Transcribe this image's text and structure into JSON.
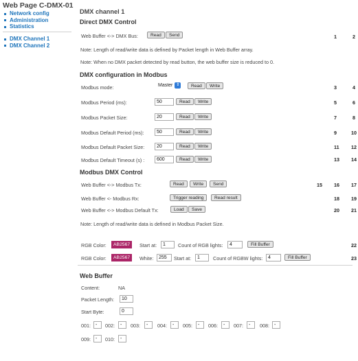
{
  "sidebar": {
    "title": "Web Page C-DMX-01",
    "nav": [
      "Network config",
      "Administration",
      "Statistics"
    ],
    "channels": [
      "DMX Channel 1",
      "DMX Channel 2"
    ]
  },
  "page_title": "DMX channel 1",
  "direct": {
    "heading": "Direct DMX Control",
    "row_label": "Web Buffer <-> DMX Bus:",
    "read": "Read",
    "send": "Send",
    "nums": [
      "1",
      "2"
    ],
    "note1": "Note: Length of read/write data is defined by Packet length in Web Buffer array.",
    "note2": "Note: When no DMX packet detected by read button, the web buffer size is reduced to 0."
  },
  "config": {
    "heading": "DMX configuration in Modbus",
    "mode": {
      "label": "Modbus mode:",
      "value": "Master",
      "read": "Read",
      "write": "Write",
      "nums": [
        "3",
        "4"
      ]
    },
    "rows": [
      {
        "label": "Modbus Period (ms):",
        "value": "50",
        "read": "Read",
        "write": "Write",
        "nums": [
          "5",
          "6"
        ]
      },
      {
        "label": "Modbus Packet Size:",
        "value": "20",
        "read": "Read",
        "write": "Write",
        "nums": [
          "7",
          "8"
        ]
      },
      {
        "label": "Modbus Default Period (ms):",
        "value": "50",
        "read": "Read",
        "write": "Write",
        "nums": [
          "9",
          "10"
        ]
      },
      {
        "label": "Modbus Default Packet Size:",
        "value": "20",
        "read": "Read",
        "write": "Write",
        "nums": [
          "11",
          "12"
        ]
      },
      {
        "label": "Modbus Default Timeout (s) :",
        "value": "600",
        "read": "Read",
        "write": "Write",
        "nums": [
          "13",
          "14"
        ]
      }
    ]
  },
  "mbdmx": {
    "heading": "Modbus DMX Control",
    "tx": {
      "label": "Web Buffer <-> Modbus Tx:",
      "read": "Read",
      "write": "Write",
      "send": "Send",
      "nums": [
        "15",
        "16",
        "17"
      ]
    },
    "rx": {
      "label": "Web Buffer <- Modbus Rx:",
      "trigger": "Trigger reading",
      "result": "Read result",
      "nums": [
        "18",
        "19"
      ]
    },
    "def": {
      "label": "Web Buffer <-> Modbus Default Tx:",
      "load": "Load",
      "save": "Save",
      "nums": [
        "20",
        "21"
      ]
    },
    "note": "Note: Length of read/write data is defined in Modbus Packet Size."
  },
  "rgb": {
    "row1": {
      "color_label": "RGB Color:",
      "color": "AB2567",
      "start_label": "Start at:",
      "start": "1",
      "count_label": "Count of RGB lights:",
      "count": "4",
      "button": "Fill Buffer",
      "num": "22"
    },
    "row2": {
      "color_label": "RGB Color:",
      "color": "AB2567",
      "white_label": "White:",
      "white": "255",
      "start_label": "Start at:",
      "start": "1",
      "count_label": "Count of RGBW lights:",
      "count": "4",
      "button": "Fill Buffer",
      "num": "23"
    }
  },
  "buffer": {
    "heading": "Web Buffer",
    "content_label": "Content:",
    "content": "NA",
    "length_label": "Packet Length:",
    "length": "10",
    "start_label": "Start Byte:",
    "start": "0",
    "cells": [
      {
        "label": "001:",
        "value": "-"
      },
      {
        "label": "002:",
        "value": "-"
      },
      {
        "label": "003:",
        "value": "-"
      },
      {
        "label": "004:",
        "value": "-"
      },
      {
        "label": "005:",
        "value": "-"
      },
      {
        "label": "006:",
        "value": "-"
      },
      {
        "label": "007:",
        "value": "-"
      },
      {
        "label": "008:",
        "value": "-"
      },
      {
        "label": "009:",
        "value": "-"
      },
      {
        "label": "010:",
        "value": "-"
      }
    ]
  },
  "colors": {
    "link": "#1d74bb",
    "swatch": "#ab2567"
  }
}
